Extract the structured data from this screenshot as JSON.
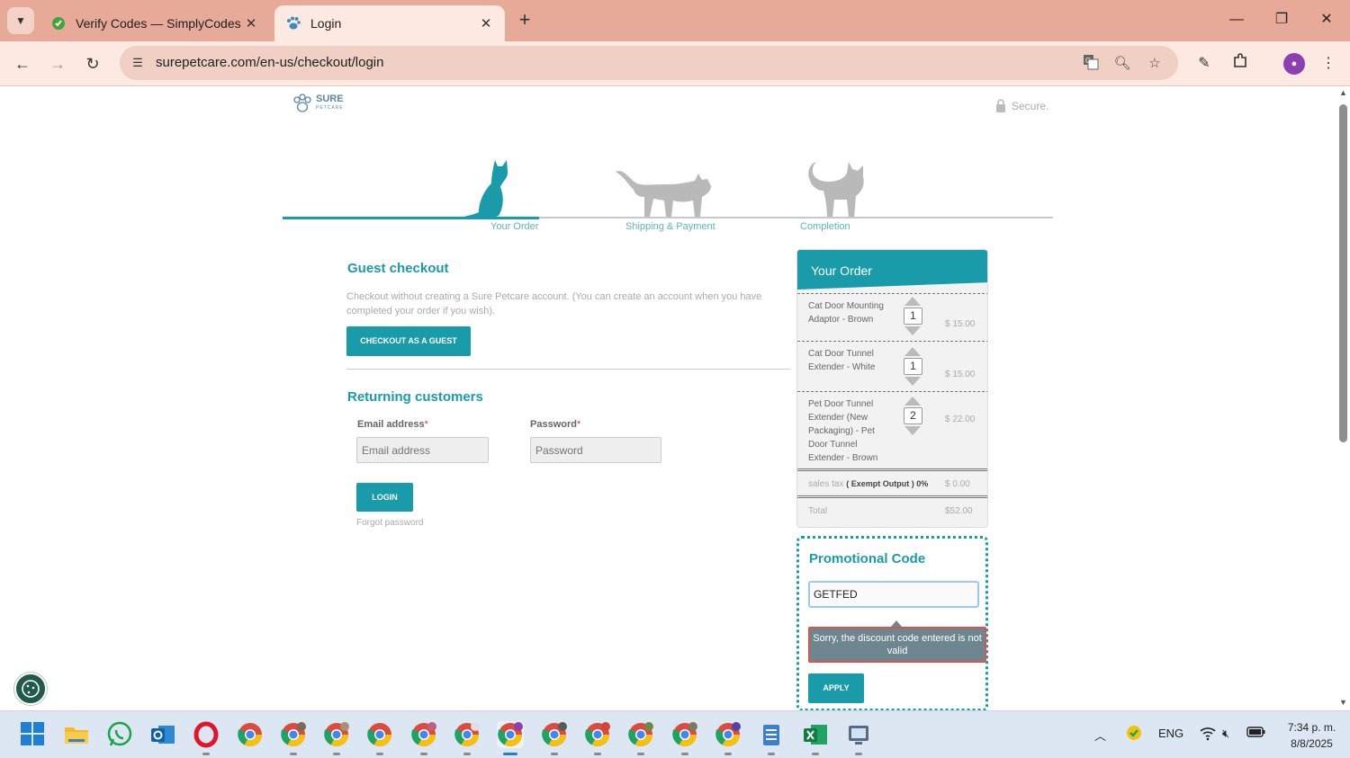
{
  "browser": {
    "tabs": [
      {
        "title": "Verify Codes — SimplyCodes",
        "active": false
      },
      {
        "title": "Login",
        "active": true
      }
    ],
    "url": "surepetcare.com/en-us/checkout/login"
  },
  "header": {
    "logo_text": "SURE",
    "logo_subtext": "PETCARE",
    "secure_label": "Secure."
  },
  "steps": [
    {
      "label": "Your Order",
      "active": true
    },
    {
      "label": "Shipping & Payment",
      "active": false
    },
    {
      "label": "Completion",
      "active": false
    }
  ],
  "guest": {
    "title": "Guest checkout",
    "description": "Checkout without creating a Sure Petcare account. (You can create an account when you have completed your order if you wish).",
    "button_label": "CHECKOUT AS A GUEST"
  },
  "returning": {
    "title": "Returning customers",
    "email_label": "Email address",
    "email_placeholder": "Email address",
    "password_label": "Password",
    "password_placeholder": "Password",
    "required_mark": "*",
    "login_label": "LOGIN",
    "forgot_label": "Forgot password"
  },
  "order": {
    "title": "Your Order",
    "items": [
      {
        "name": "Cat Door Mounting Adaptor - Brown",
        "qty": "1",
        "price": "$ 15.00"
      },
      {
        "name": "Cat Door Tunnel Extender - White",
        "qty": "1",
        "price": "$ 15.00"
      },
      {
        "name": "Pet Door Tunnel Extender (New Packaging) - Pet Door Tunnel Extender - Brown",
        "qty": "2",
        "price": "$ 22.00"
      }
    ],
    "tax_label": "sales tax",
    "tax_note": "( Exempt Output ) 0%",
    "tax_value": "$ 0.00",
    "total_label": "Total",
    "total_value": "$52.00"
  },
  "promo": {
    "title": "Promotional Code",
    "value": "GETFED",
    "error": "Sorry, the discount code entered is not valid",
    "apply_label": "APPLY"
  },
  "taskbar": {
    "language": "ENG",
    "time": "7:34 p. m.",
    "date": "8/8/2025"
  },
  "colors": {
    "brand_teal": "#1a9ba9",
    "tab_bar": "#e8aa98",
    "error_border": "#d9534f"
  }
}
